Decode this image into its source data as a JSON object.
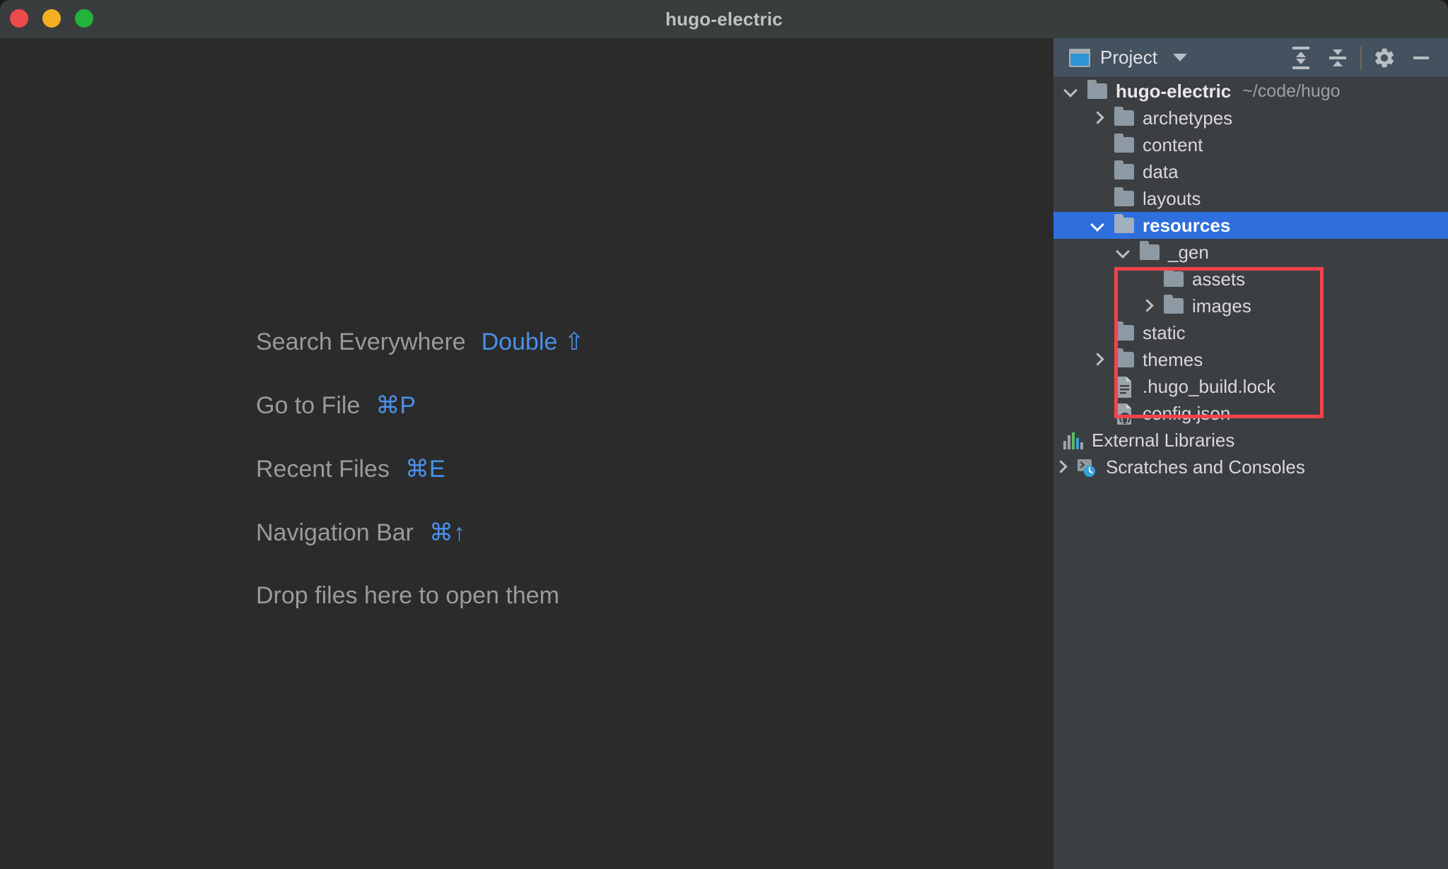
{
  "window": {
    "title": "hugo-electric",
    "traffic_lights": [
      "close-button",
      "minimize-button",
      "maximize-button"
    ]
  },
  "editor": {
    "hints": [
      {
        "label": "Search Everywhere",
        "key": "Double ⇧"
      },
      {
        "label": "Go to File",
        "key": "⌘P"
      },
      {
        "label": "Recent Files",
        "key": "⌘E"
      },
      {
        "label": "Navigation Bar",
        "key": "⌘↑"
      }
    ],
    "drop_hint": "Drop files here to open them"
  },
  "project_panel": {
    "title": "Project",
    "icon": "project-window-icon",
    "toolbar": [
      {
        "name": "expand-all-icon",
        "label": "Expand All"
      },
      {
        "name": "collapse-all-icon",
        "label": "Collapse All"
      },
      {
        "name": "settings-gear-icon",
        "label": "Settings"
      },
      {
        "name": "hide-panel-icon",
        "label": "Hide"
      }
    ],
    "tree": [
      {
        "label": "hugo-electric",
        "path": "~/code/hugo",
        "icon": "folder-icon",
        "twisty": "down",
        "indent": 0,
        "kind": "root"
      },
      {
        "label": "archetypes",
        "icon": "folder-icon",
        "twisty": "right",
        "indent": 1,
        "kind": "folder"
      },
      {
        "label": "content",
        "icon": "folder-icon",
        "twisty": "none",
        "indent": 1,
        "kind": "folder"
      },
      {
        "label": "data",
        "icon": "folder-icon",
        "twisty": "none",
        "indent": 1,
        "kind": "folder"
      },
      {
        "label": "layouts",
        "icon": "folder-icon",
        "twisty": "none",
        "indent": 1,
        "kind": "folder"
      },
      {
        "label": "resources",
        "icon": "folder-icon",
        "twisty": "down",
        "indent": 1,
        "kind": "folder",
        "selected": true
      },
      {
        "label": "_gen",
        "icon": "folder-icon",
        "twisty": "down",
        "indent": 2,
        "kind": "folder"
      },
      {
        "label": "assets",
        "icon": "folder-icon",
        "twisty": "none",
        "indent": 3,
        "kind": "folder"
      },
      {
        "label": "images",
        "icon": "folder-icon",
        "twisty": "right",
        "indent": 3,
        "kind": "folder"
      },
      {
        "label": "static",
        "icon": "folder-icon",
        "twisty": "none",
        "indent": 1,
        "kind": "folder"
      },
      {
        "label": "themes",
        "icon": "folder-icon",
        "twisty": "right",
        "indent": 1,
        "kind": "folder"
      },
      {
        "label": ".hugo_build.lock",
        "icon": "text-file-icon",
        "twisty": "none",
        "indent": 1,
        "kind": "file"
      },
      {
        "label": "config.json",
        "icon": "json-file-icon",
        "twisty": "none",
        "indent": 1,
        "kind": "file"
      },
      {
        "label": "External Libraries",
        "icon": "external-libraries-icon",
        "twisty": "none",
        "indent": 0,
        "kind": "node"
      },
      {
        "label": "Scratches and Consoles",
        "icon": "scratches-icon",
        "twisty": "right",
        "indent": 0,
        "kind": "node"
      }
    ]
  },
  "annotation": {
    "color": "#f5424b",
    "targets": [
      "resources",
      "_gen",
      "assets",
      "images"
    ]
  }
}
